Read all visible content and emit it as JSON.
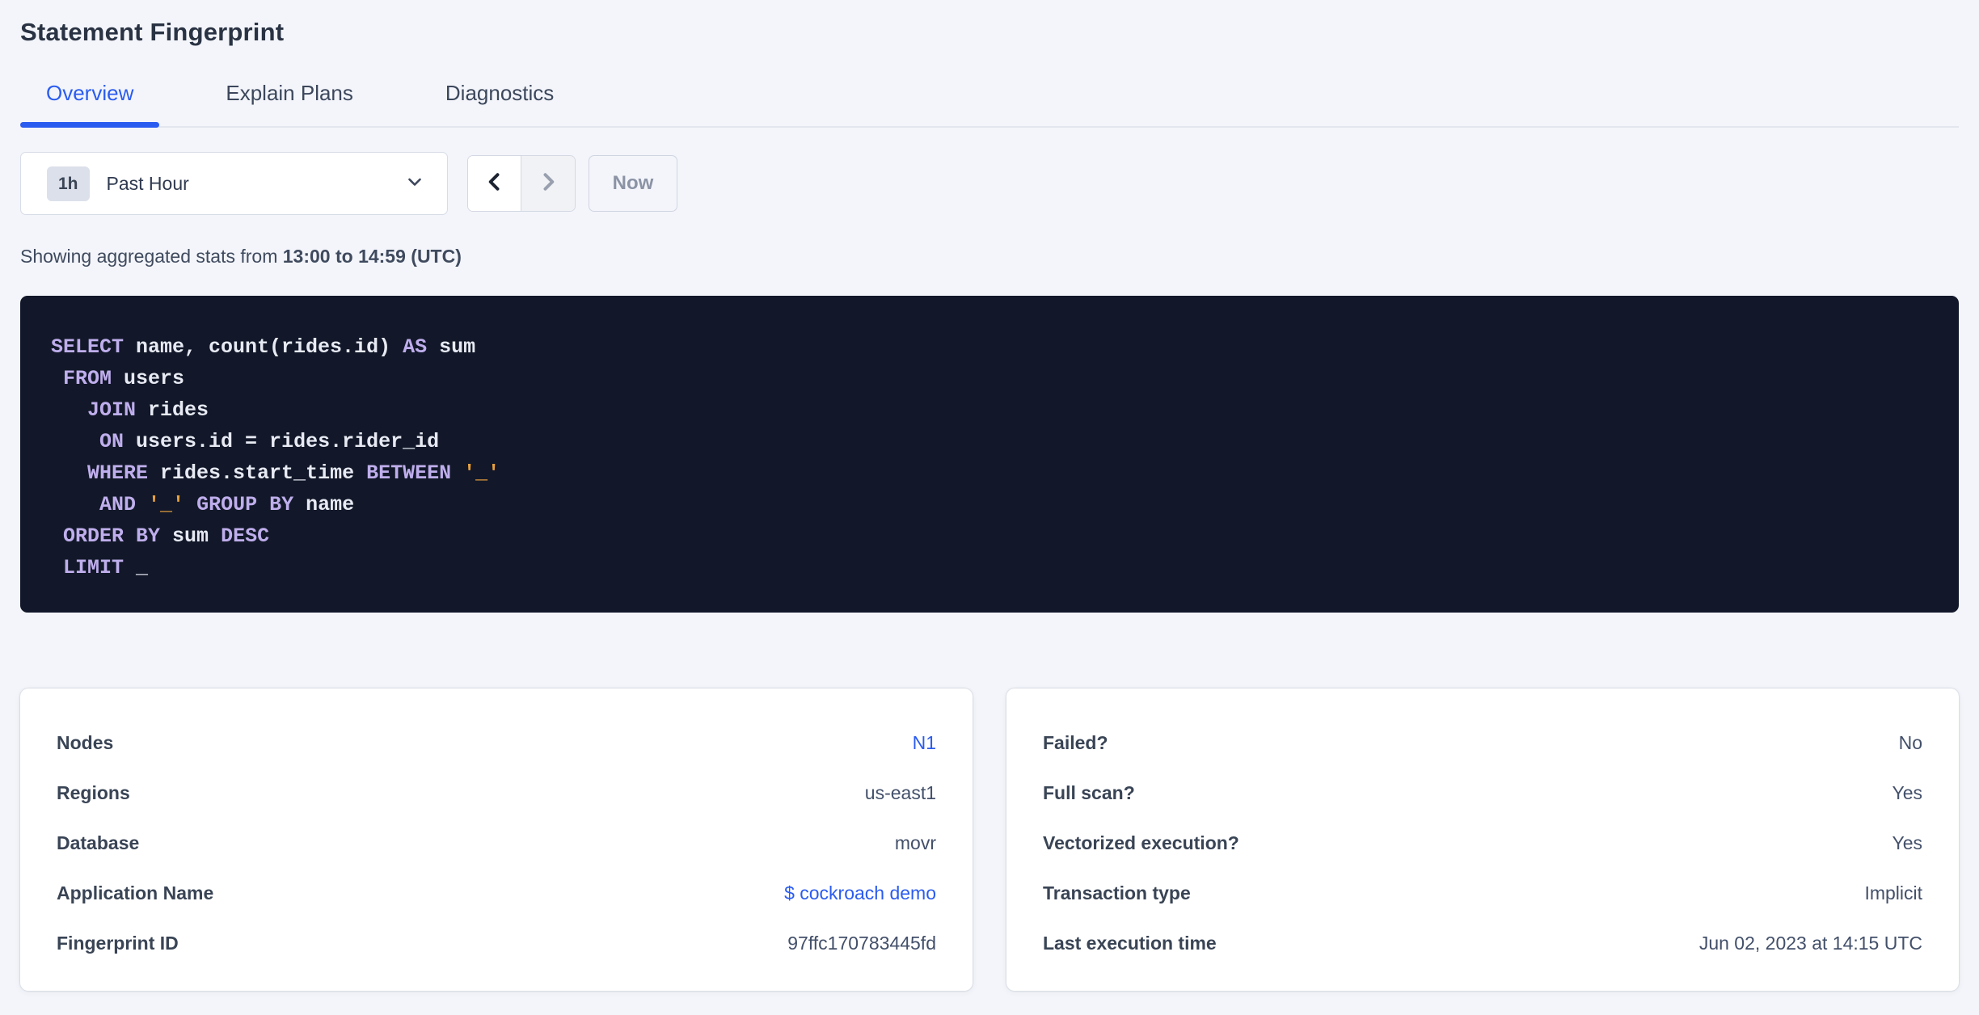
{
  "page": {
    "title": "Statement Fingerprint"
  },
  "tabs": [
    {
      "label": "Overview",
      "active": true
    },
    {
      "label": "Explain Plans",
      "active": false
    },
    {
      "label": "Diagnostics",
      "active": false
    }
  ],
  "time_picker": {
    "badge": "1h",
    "label": "Past Hour",
    "now_label": "Now",
    "prev_enabled": true,
    "next_enabled": false,
    "now_enabled": false
  },
  "stats_line": {
    "prefix": "Showing aggregated stats from ",
    "range": "13:00 to 14:59 (UTC)"
  },
  "sql": {
    "lines": [
      [
        {
          "t": "SELECT",
          "c": "kw"
        },
        {
          "t": " name, count(rides.id) ",
          "c": "id"
        },
        {
          "t": "AS",
          "c": "kw"
        },
        {
          "t": " sum",
          "c": "id"
        }
      ],
      [
        {
          "t": " ",
          "c": "id"
        },
        {
          "t": "FROM",
          "c": "kw"
        },
        {
          "t": " users",
          "c": "id"
        }
      ],
      [
        {
          "t": "   ",
          "c": "id"
        },
        {
          "t": "JOIN",
          "c": "kw"
        },
        {
          "t": " rides",
          "c": "id"
        }
      ],
      [
        {
          "t": "    ",
          "c": "id"
        },
        {
          "t": "ON",
          "c": "kw"
        },
        {
          "t": " users.id = rides.rider_id",
          "c": "id"
        }
      ],
      [
        {
          "t": "   ",
          "c": "id"
        },
        {
          "t": "WHERE",
          "c": "kw"
        },
        {
          "t": " rides.start_time ",
          "c": "id"
        },
        {
          "t": "BETWEEN",
          "c": "kw"
        },
        {
          "t": " ",
          "c": "id"
        },
        {
          "t": "'_'",
          "c": "str"
        }
      ],
      [
        {
          "t": "    ",
          "c": "id"
        },
        {
          "t": "AND",
          "c": "kw"
        },
        {
          "t": " ",
          "c": "id"
        },
        {
          "t": "'_'",
          "c": "str"
        },
        {
          "t": " ",
          "c": "id"
        },
        {
          "t": "GROUP BY",
          "c": "kw"
        },
        {
          "t": " name",
          "c": "id"
        }
      ],
      [
        {
          "t": " ",
          "c": "id"
        },
        {
          "t": "ORDER BY",
          "c": "kw"
        },
        {
          "t": " sum ",
          "c": "id"
        },
        {
          "t": "DESC",
          "c": "kw"
        }
      ],
      [
        {
          "t": " ",
          "c": "id"
        },
        {
          "t": "LIMIT",
          "c": "kw"
        },
        {
          "t": " _",
          "c": "id"
        }
      ]
    ]
  },
  "cards": {
    "left": {
      "rows": [
        {
          "label": "Nodes",
          "value": "N1",
          "link": true
        },
        {
          "label": "Regions",
          "value": "us-east1",
          "link": false
        },
        {
          "label": "Database",
          "value": "movr",
          "link": false
        },
        {
          "label": "Application Name",
          "value": "$ cockroach demo",
          "link": true
        },
        {
          "label": "Fingerprint ID",
          "value": "97ffc170783445fd",
          "link": false
        }
      ]
    },
    "right": {
      "rows": [
        {
          "label": "Failed?",
          "value": "No",
          "link": false
        },
        {
          "label": "Full scan?",
          "value": "Yes",
          "link": false
        },
        {
          "label": "Vectorized execution?",
          "value": "Yes",
          "link": false
        },
        {
          "label": "Transaction type",
          "value": "Implicit",
          "link": false
        },
        {
          "label": "Last execution time",
          "value": "Jun 02, 2023 at 14:15 UTC",
          "link": false
        }
      ]
    }
  },
  "colors": {
    "accent_blue": "#2b5cf0",
    "page_background": "#f3f5fa",
    "code_background": "#121829",
    "code_keyword": "#bfaeec",
    "code_identifier": "#e7eaf3",
    "code_string": "#e9a13e"
  }
}
